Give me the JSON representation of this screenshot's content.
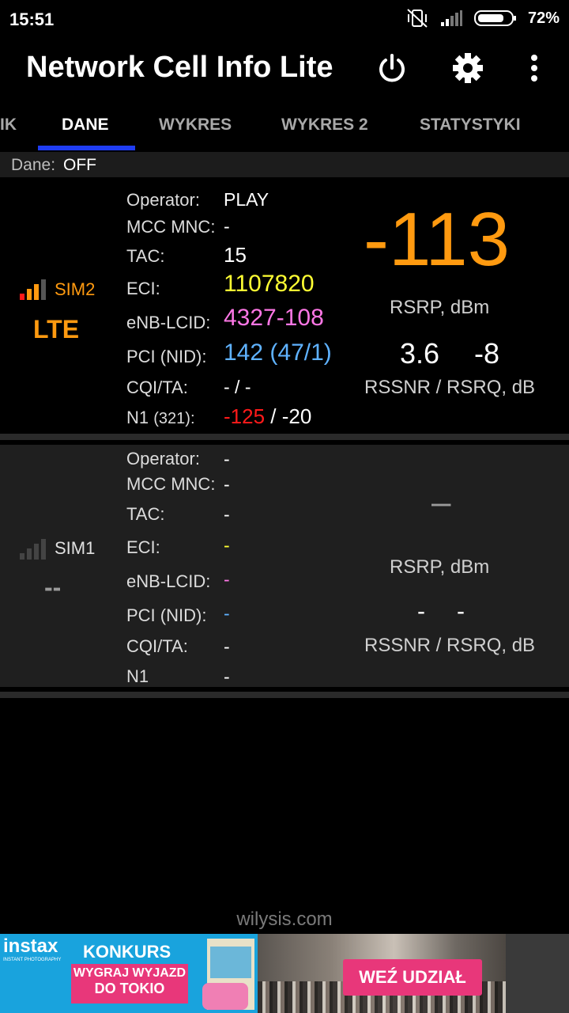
{
  "status": {
    "time": "15:51",
    "battery": "72%"
  },
  "app": {
    "title": "Network Cell Info Lite"
  },
  "tabs": [
    "IK",
    "DANE",
    "WYKRES",
    "WYKRES 2",
    "STATYSTYKI"
  ],
  "dane": {
    "label": "Dane:",
    "value": "OFF"
  },
  "labels": {
    "operator": "Operator:",
    "mcc": "MCC MNC:",
    "tac": "TAC:",
    "eci": "ECI:",
    "enb": "eNB-LCID:",
    "pci": "PCI (NID):",
    "cqi": "CQI/TA:",
    "n1": "N1",
    "rsrp_unit": "RSRP, dBm",
    "snr_unit": "RSSNR / RSRQ, dB"
  },
  "sim2": {
    "name": "SIM2",
    "rat": "LTE",
    "operator": "PLAY",
    "mcc": "-",
    "tac": "15",
    "eci": "1107820",
    "enb": "4327-108",
    "pci": "142 (47/1)",
    "cqi": "- / -",
    "n1_arfcn": "(321):",
    "n1_rsrp": "-125",
    "n1_sep": " / ",
    "n1_rsrq": "-20",
    "rsrp": "-113",
    "rssnr": "3.6",
    "rsrq": "-8",
    "colors": {
      "accent": "#ff9a10",
      "eci": "#ffff33",
      "enb": "#ff77e6",
      "pci": "#5fb2ff",
      "n1": "#ff1a1a"
    }
  },
  "sim1": {
    "name": "SIM1",
    "rat": "--",
    "operator": "-",
    "mcc": "-",
    "tac": "-",
    "eci": "-",
    "enb": "-",
    "pci": "-",
    "cqi": "-",
    "n1": "-",
    "rsrp": "–",
    "rssnr": "-",
    "rsrq": "-"
  },
  "footer": "wilysis.com",
  "ad": {
    "brand": "instax",
    "brand_sub": "INSTANT PHOTOGRAPHY",
    "headline": "KONKURS",
    "line1": "WYGRAJ WYJAZD",
    "line2": "DO TOKIO",
    "cta": "WEŹ UDZIAŁ"
  }
}
